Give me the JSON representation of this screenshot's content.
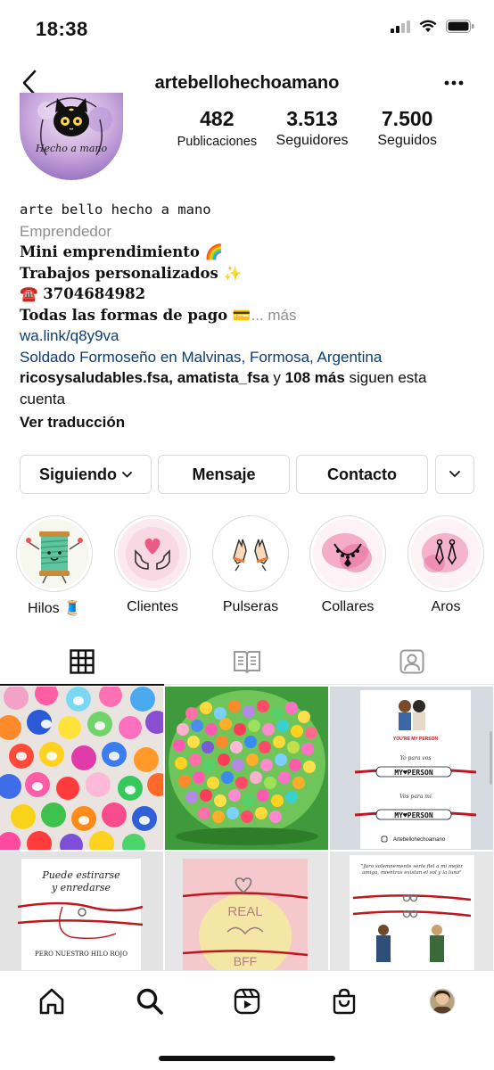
{
  "status_bar": {
    "time": "18:38",
    "icons": [
      "signal-icon",
      "wifi-icon",
      "battery-icon"
    ]
  },
  "header": {
    "username": "artebellohechoamano",
    "back_icon": "chevron-left-icon",
    "more_icon": "more-horizontal-icon"
  },
  "avatar": {
    "text": "Hecho a mano"
  },
  "stats": [
    {
      "value": "482",
      "label": "Publicaciones"
    },
    {
      "value": "3.513",
      "label": "Seguidores"
    },
    {
      "value": "7.500",
      "label": "Seguidos"
    }
  ],
  "bio": {
    "name": "arte bello hecho a mano",
    "category": "Emprendedor",
    "line1": "Mini emprendimiento 🌈",
    "line2": "Trabajos personalizados ✨",
    "line3": "☎️ 3704684982",
    "line4": "Todas las formas de pago 💳",
    "more": "... más",
    "link": "wa.link/q8y9va",
    "location": "Soldado Formoseño en Malvinas, Formosa, Argentina",
    "followed_by_names": "ricosysaludables.fsa, amatista_fsa",
    "followed_by_joiner": " y ",
    "followed_by_count": "108 más",
    "followed_by_suffix": " siguen esta cuenta",
    "translate": "Ver traducción"
  },
  "buttons": {
    "following": "Siguiendo",
    "message": "Mensaje",
    "contact": "Contacto"
  },
  "highlights": [
    {
      "label": "Hilos 🧵"
    },
    {
      "label": "Clientes"
    },
    {
      "label": "Pulseras"
    },
    {
      "label": "Collares"
    },
    {
      "label": "Aros"
    }
  ],
  "tabs": [
    {
      "icon": "grid-icon",
      "active": true
    },
    {
      "icon": "guide-icon",
      "active": false
    },
    {
      "icon": "tagged-icon",
      "active": false
    }
  ],
  "posts": {
    "card_my_person": {
      "title": "YOU'RE MY PERSON",
      "line_a": "Yo para vos",
      "line_b": "Vos para mi",
      "beads": "MY♥PERSON",
      "handle": "Artebellohechoamano"
    },
    "card_hilo": {
      "line1": "Puede estirarse",
      "line2": "y enredarse",
      "line3": "PERO NUESTRO HILO ROJO"
    },
    "card_bff": {
      "top": "REAL",
      "bottom": "BFF"
    },
    "card_quote": {
      "text": "\"Juro solemnemente serle fiel a mi mejor amiga, mientras existan el sol y la luna\""
    }
  },
  "bottom_nav": [
    "home-icon",
    "search-icon",
    "reels-icon",
    "shop-icon",
    "profile-avatar"
  ],
  "colors": {
    "link": "#0a3d78",
    "muted": "#8e8e8e",
    "border": "#dbdbdb",
    "red_thread": "#c0161d"
  }
}
